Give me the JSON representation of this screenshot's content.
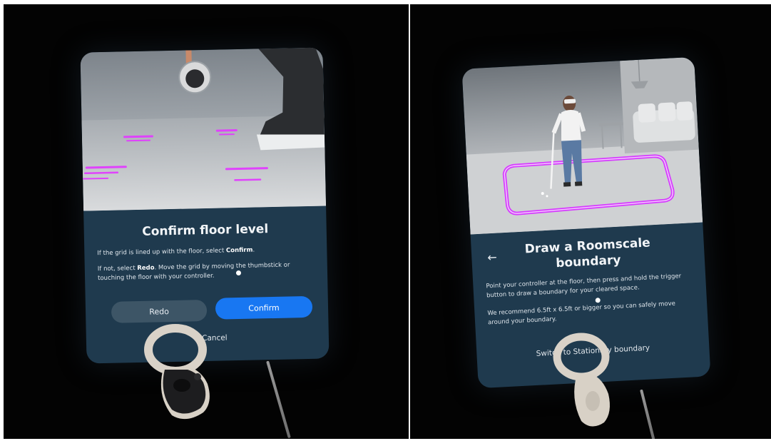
{
  "left_panel": {
    "title": "Confirm floor level",
    "desc1_pre": "If the grid is lined up with the floor, select ",
    "desc1_bold": "Confirm",
    "desc1_post": ".",
    "desc2_pre": "If not, select ",
    "desc2_bold": "Redo",
    "desc2_post": ". Move the grid by moving the thumbstick or touching the floor with your controller.",
    "redo_label": "Redo",
    "confirm_label": "Confirm",
    "cancel_label": "Cancel"
  },
  "right_panel": {
    "title": "Draw a Roomscale boundary",
    "desc1": "Point your controller at the floor, then press and hold the trigger button to draw a boundary for your cleared space.",
    "desc2": "We recommend 6.5ft x 6.5ft or bigger so you can safely move around your boundary.",
    "switch_label": "Switch to Stationary boundary",
    "back_icon": "back-arrow-icon"
  },
  "colors": {
    "panel_bg": "#1f3a4e",
    "confirm_blue": "#1877f2",
    "redo_gray": "#3d5566",
    "boundary_magenta": "#d63cff"
  }
}
